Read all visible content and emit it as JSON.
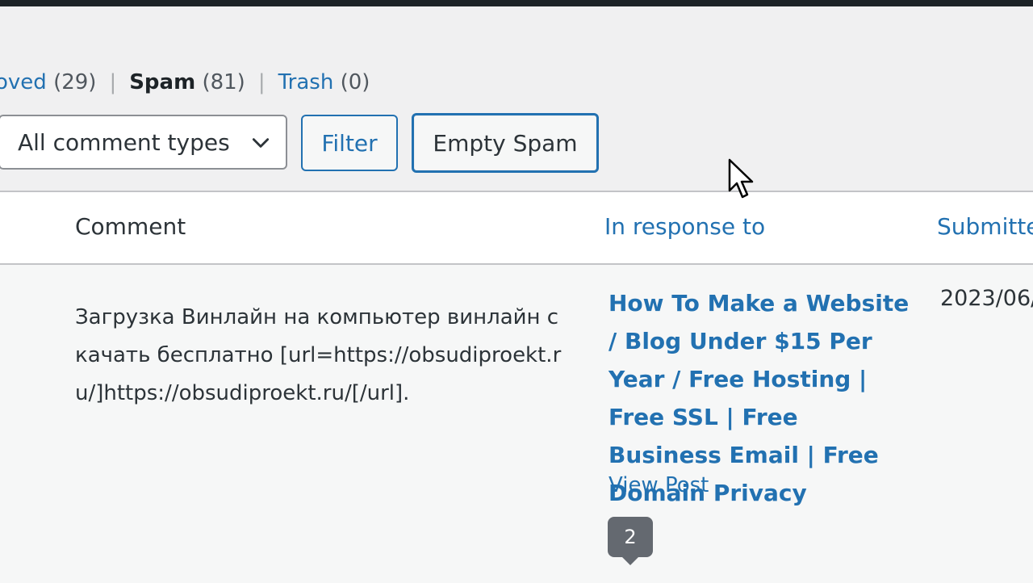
{
  "filters": {
    "approved_partial": "oved",
    "approved_count": "(29)",
    "spam_label": "Spam",
    "spam_count": "(81)",
    "trash_label": "Trash",
    "trash_count": "(0)",
    "separator": "|"
  },
  "toolbar": {
    "comment_type_selected": "All comment types",
    "filter_label": "Filter",
    "empty_spam_label": "Empty Spam"
  },
  "table": {
    "headers": {
      "comment": "Comment",
      "in_response_to": "In response to",
      "submitted": "Submitte"
    },
    "rows": [
      {
        "comment": "Загрузка Винлайн на компьютер винлайн скачать бесплатно [url=https://obsudiproekt.ru/]https://obsudiproekt.ru/[/url].",
        "post_title": "How To Make a Website / Blog Under $15 Per Year / Free Hosting | Free SSL | Free Business Email | Free Domain Privacy",
        "view_post": "View Post",
        "comment_count": "2",
        "submitted": "2023/06/"
      }
    ]
  },
  "colors": {
    "accent": "#2271b1",
    "background": "#f0f0f1",
    "bubble": "#646970"
  },
  "icons": {
    "dropdown": "chevron-down-icon",
    "cursor": "mouse-pointer-icon"
  }
}
